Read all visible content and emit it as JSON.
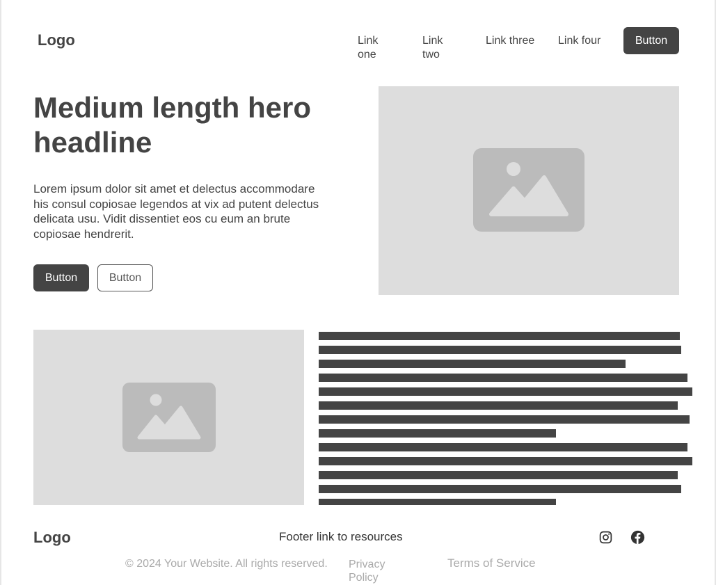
{
  "header": {
    "logo": "Logo",
    "nav": [
      {
        "label": "Link one"
      },
      {
        "label": "Link two"
      },
      {
        "label": "Link three"
      },
      {
        "label": "Link four"
      }
    ],
    "button_label": "Button"
  },
  "hero": {
    "headline": "Medium length hero headline",
    "body": "Lorem ipsum dolor sit amet et delectus accommodare his consul copiosae legendos at vix ad putent delectus delicata usu. Vidit dissentiet eos cu eum an brute copiosae hendrerit.",
    "primary_button": "Button",
    "secondary_button": "Button",
    "image_icon": "image-placeholder-icon"
  },
  "feature": {
    "image_icon": "image-placeholder-icon",
    "text_block_icon": "placeholder-text-lines"
  },
  "footer": {
    "logo": "Logo",
    "resources_link": "Footer link to resources",
    "social": [
      {
        "icon": "instagram-icon"
      },
      {
        "icon": "facebook-icon"
      }
    ],
    "copyright": "© 2024 Your Website. All rights reserved.",
    "privacy": "Privacy Policy",
    "terms": "Terms of Service"
  },
  "colors": {
    "primary": "#444444",
    "placeholder_bg": "#dddddd",
    "placeholder_icon": "#bbbbbb",
    "muted_text": "#aaaaaa"
  }
}
